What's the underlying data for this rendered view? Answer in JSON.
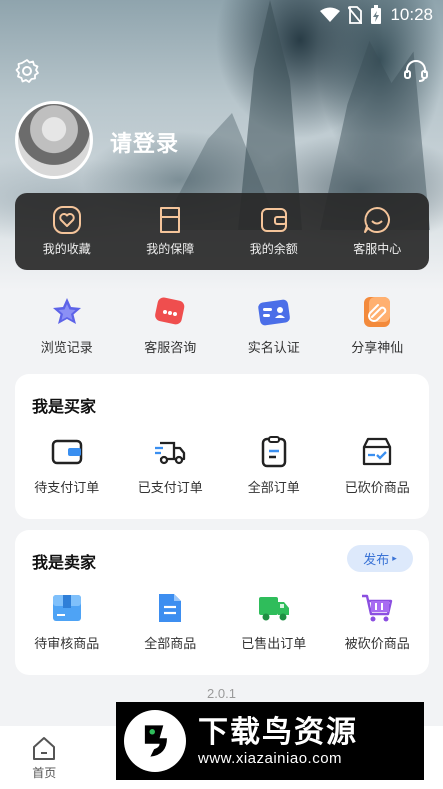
{
  "status_bar": {
    "time": "10:28",
    "icons": [
      "wifi-icon",
      "no-sim-icon",
      "battery-charging-icon"
    ]
  },
  "header": {
    "login_label": "请登录"
  },
  "quick_card": {
    "items": [
      {
        "label": "我的收藏",
        "icon": "heart-icon"
      },
      {
        "label": "我的保障",
        "icon": "shield-cup-icon"
      },
      {
        "label": "我的余额",
        "icon": "wallet-icon"
      },
      {
        "label": "客服中心",
        "icon": "chat-smile-icon"
      }
    ]
  },
  "features": {
    "items": [
      {
        "label": "浏览记录",
        "icon": "star-icon"
      },
      {
        "label": "客服咨询",
        "icon": "message-icon"
      },
      {
        "label": "实名认证",
        "icon": "id-card-icon"
      },
      {
        "label": "分享神仙",
        "icon": "share-link-icon"
      }
    ]
  },
  "buyer": {
    "title": "我是买家",
    "items": [
      {
        "label": "待支付订单",
        "icon": "wallet-pending-icon"
      },
      {
        "label": "已支付订单",
        "icon": "truck-icon"
      },
      {
        "label": "全部订单",
        "icon": "clipboard-icon"
      },
      {
        "label": "已砍价商品",
        "icon": "box-check-icon"
      }
    ]
  },
  "seller": {
    "title": "我是卖家",
    "publish_label": "发布",
    "items": [
      {
        "label": "待审核商品",
        "icon": "package-review-icon"
      },
      {
        "label": "全部商品",
        "icon": "document-icon"
      },
      {
        "label": "已售出订单",
        "icon": "delivery-truck-icon"
      },
      {
        "label": "被砍价商品",
        "icon": "cart-icon"
      }
    ]
  },
  "version": "2.0.1",
  "bottom_nav": {
    "items": [
      {
        "label": "首页",
        "icon": "home-icon"
      }
    ]
  },
  "watermark": {
    "title": "下载鸟资源",
    "url": "www.xiazainiao.com"
  },
  "colors": {
    "accent_blue": "#3a73d6",
    "dark_card": "#282828",
    "background": "#f2f3f5"
  }
}
